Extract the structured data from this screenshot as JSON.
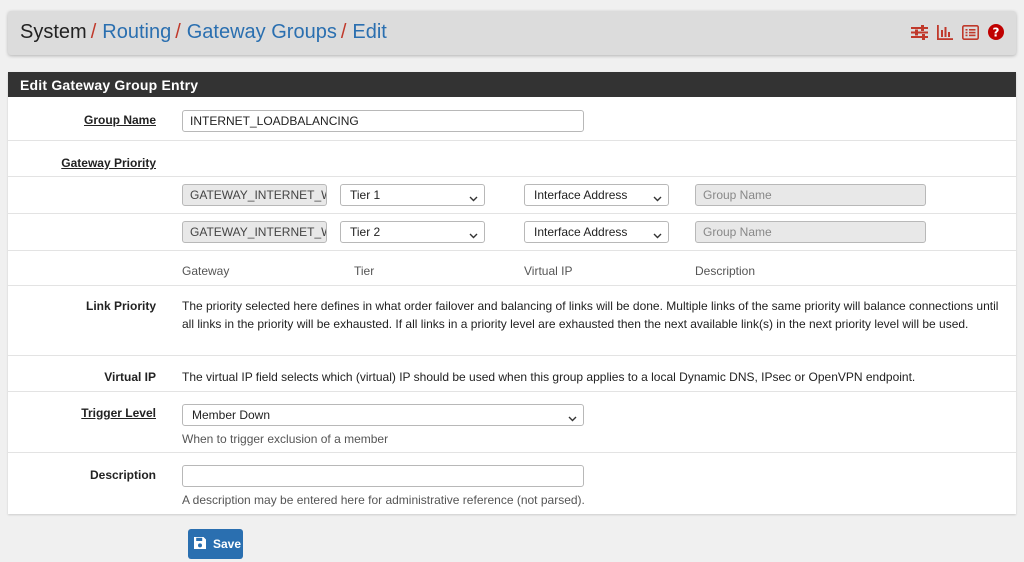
{
  "breadcrumb": {
    "items": [
      "System",
      "Routing",
      "Gateway Groups",
      "Edit"
    ],
    "separator": "/"
  },
  "toolbar": {
    "icons": [
      "sliders-icon",
      "bar-chart-icon",
      "list-icon",
      "help-icon"
    ]
  },
  "panel": {
    "title": "Edit Gateway Group Entry"
  },
  "group_name": {
    "label": "Group Name",
    "value": "INTERNET_LOADBALANCING"
  },
  "gateway_priority": {
    "label": "Gateway Priority",
    "rows": [
      {
        "gateway": "GATEWAY_INTERNET_W",
        "tier": "Tier 1",
        "virtual_ip": "Interface Address",
        "description_placeholder": "Group Name"
      },
      {
        "gateway": "GATEWAY_INTERNET_W",
        "tier": "Tier 2",
        "virtual_ip": "Interface Address",
        "description_placeholder": "Group Name"
      }
    ],
    "columns": [
      "Gateway",
      "Tier",
      "Virtual IP",
      "Description"
    ]
  },
  "link_priority": {
    "label": "Link Priority",
    "text": "The priority selected here defines in what order failover and balancing of links will be done. Multiple links of the same priority will balance connections until all links in the priority will be exhausted. If all links in a priority level are exhausted then the next available link(s) in the next priority level will be used."
  },
  "virtual_ip": {
    "label": "Virtual IP",
    "text": "The virtual IP field selects which (virtual) IP should be used when this group applies to a local Dynamic DNS, IPsec or OpenVPN endpoint."
  },
  "trigger_level": {
    "label": "Trigger Level",
    "value": "Member Down",
    "help": "When to trigger exclusion of a member"
  },
  "description": {
    "label": "Description",
    "value": "",
    "help": "A description may be entered here for administrative reference (not parsed)."
  },
  "save_button": {
    "label": "Save"
  },
  "colors": {
    "link": "#2a6fb0",
    "separator": "#c0392b",
    "panel_header": "#333333",
    "icon_red": "#c0392b"
  }
}
